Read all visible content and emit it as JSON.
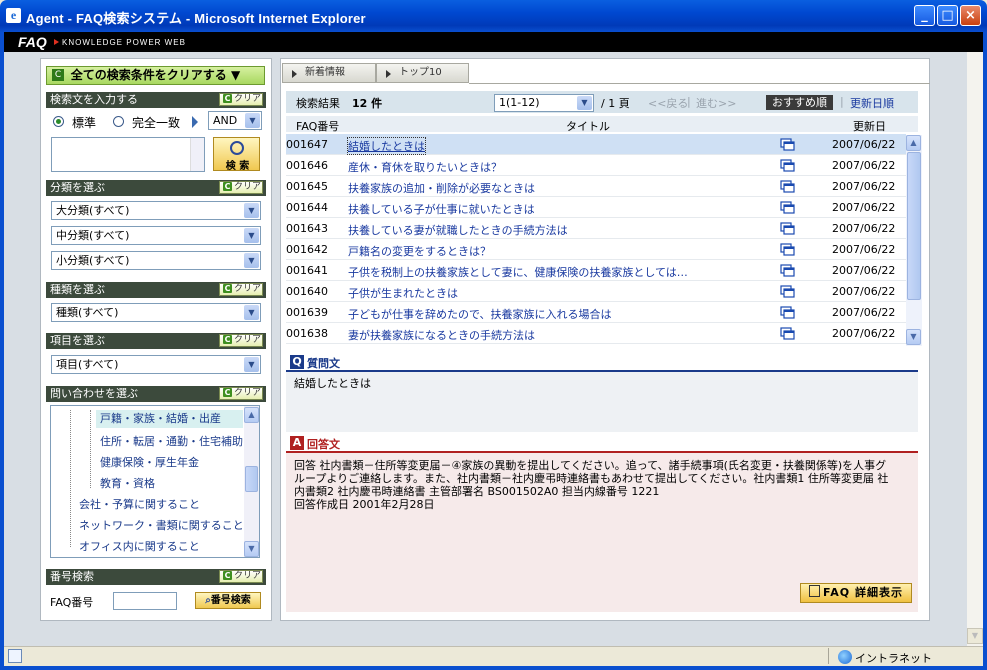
{
  "window": {
    "title": "Agent - FAQ検索システム - Microsoft Internet Explorer"
  },
  "header": {
    "logo": "FAQ",
    "tagline": "KNOWLEDGE POWER WEB"
  },
  "left": {
    "clear_all": "全ての検索条件をクリアする ▼",
    "clear_label": "クリア",
    "keyword": {
      "heading": "検索文を入力する",
      "mode_standard": "標準",
      "mode_exact": "完全一致",
      "operator": "AND",
      "value": "",
      "search_button": "検 索"
    },
    "category": {
      "heading": "分類を選ぶ",
      "large": "大分類(すべて)",
      "medium": "中分類(すべて)",
      "small": "小分類(すべて)"
    },
    "kind": {
      "heading": "種類を選ぶ",
      "value": "種類(すべて)"
    },
    "item": {
      "heading": "項目を選ぶ",
      "value": "項目(すべて)"
    },
    "inquiry": {
      "heading": "問い合わせを選ぶ",
      "items": [
        "戸籍・家族・結婚・出産",
        "住所・転居・通勤・住宅補助",
        "健康保険・厚生年金",
        "教育・資格",
        "会社・予算に関すること",
        "ネットワーク・書類に関すること",
        "オフィス内に関すること"
      ]
    },
    "number": {
      "heading": "番号検索",
      "label": "FAQ番号",
      "value": "",
      "button": "番号検索"
    }
  },
  "right": {
    "tabs": [
      "新着情報",
      "トップ10"
    ],
    "results": {
      "label": "検索結果",
      "count": "12 件",
      "page_select": "1(1-12)",
      "page_total": "/ 1 頁",
      "prev": "<<戻る",
      "sep": "|",
      "next": "進む>>",
      "sort_recommend": "おすすめ順",
      "sort_date": "更新日順"
    },
    "columns": {
      "no": "FAQ番号",
      "title": "タイトル",
      "date": "更新日"
    },
    "rows": [
      {
        "no": "001647",
        "title": "結婚したときは",
        "date": "2007/06/22"
      },
      {
        "no": "001646",
        "title": "産休・育休を取りたいときは？",
        "date": "2007/06/22"
      },
      {
        "no": "001645",
        "title": "扶養家族の追加・削除が必要なときは",
        "date": "2007/06/22"
      },
      {
        "no": "001644",
        "title": "扶養している子が仕事に就いたときは",
        "date": "2007/06/22"
      },
      {
        "no": "001643",
        "title": "扶養している妻が就職したときの手続方法は",
        "date": "2007/06/22"
      },
      {
        "no": "001642",
        "title": "戸籍名の変更をするときは？",
        "date": "2007/06/22"
      },
      {
        "no": "001641",
        "title": "子供を税制上の扶養家族として妻に、健康保険の扶養家族としては…",
        "date": "2007/06/22"
      },
      {
        "no": "001640",
        "title": "子供が生まれたときは",
        "date": "2007/06/22"
      },
      {
        "no": "001639",
        "title": "子どもが仕事を辞めたので、扶養家族に入れる場合は",
        "date": "2007/06/22"
      },
      {
        "no": "001638",
        "title": "妻が扶養家族になるときの手続方法は",
        "date": "2007/06/22"
      }
    ],
    "question": {
      "badge": "Q",
      "heading": "質問文",
      "text": "結婚したときは"
    },
    "answer": {
      "badge": "A",
      "heading": "回答文",
      "line1": "回答 社内書類－住所等変更届－④家族の異動を提出してください。追って、諸手続事項(氏名変更・扶養関係等)を人事グ",
      "line2": "ループよりご連絡します。また、社内書類－社内慶弔時連絡書もあわせて提出してください。社内書類1 住所等変更届 社",
      "line3": "内書類2 社内慶弔時連絡書 主管部署名 BS001502A0 担当内線番号 1221",
      "line4": "回答作成日 2001年2月28日"
    },
    "detail_button": "FAQ 詳細表示"
  },
  "status": {
    "zone": "イントラネット"
  },
  "colors": {
    "titlebar": "#0048d0",
    "section_header": "#3c4a3c",
    "link": "#1a3aa0",
    "answer_accent": "#b02020",
    "question_accent": "#1a3a8a"
  }
}
